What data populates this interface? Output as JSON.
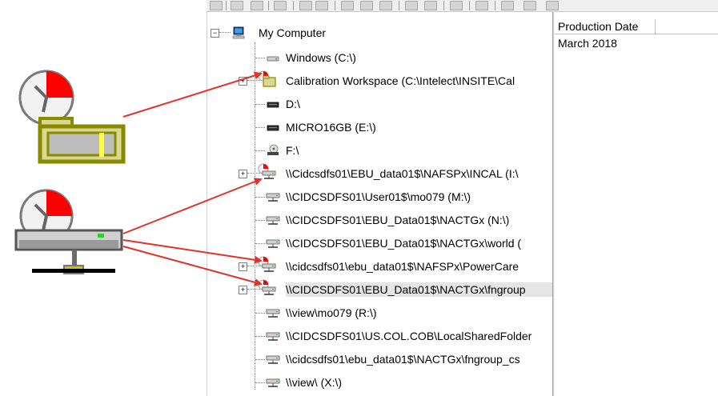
{
  "tree": {
    "root": {
      "label": "My Computer",
      "icon": "computer-icon"
    },
    "items": [
      {
        "label": "Windows  (C:\\)",
        "icon": "hard-drive-icon",
        "expandable": false
      },
      {
        "label": "Calibration Workspace  (C:\\Intelect\\INSITE\\Cal",
        "icon": "offline-shared-folder-icon",
        "expandable": true
      },
      {
        "label": "D:\\",
        "icon": "optical-drive-icon",
        "expandable": false
      },
      {
        "label": "MICRO16GB  (E:\\)",
        "icon": "removable-drive-icon",
        "expandable": false
      },
      {
        "label": "F:\\",
        "icon": "cd-drive-icon",
        "expandable": false
      },
      {
        "label": "\\\\Cidcsdfs01\\EBU_data01$\\NAFSPx\\INCAL  (I:\\",
        "icon": "offline-network-drive-icon",
        "expandable": true
      },
      {
        "label": "\\\\CIDCSDFS01\\User01$\\mo079  (M:\\)",
        "icon": "network-drive-icon",
        "expandable": false
      },
      {
        "label": "\\\\CIDCSDFS01\\EBU_Data01$\\NACTGx  (N:\\)",
        "icon": "network-drive-icon",
        "expandable": false
      },
      {
        "label": "\\\\CIDCSDFS01\\EBU_Data01$\\NACTGx\\world  (",
        "icon": "network-drive-icon",
        "expandable": false
      },
      {
        "label": "\\\\cidcsdfs01\\ebu_data01$\\NAFSPx\\PowerCare",
        "icon": "offline-network-drive-icon",
        "expandable": true
      },
      {
        "label": "\\\\CIDCSDFS01\\EBU_Data01$\\NACTGx\\fngroup",
        "icon": "offline-network-drive-icon",
        "expandable": true,
        "selected": true
      },
      {
        "label": "\\\\view\\mo079  (R:\\)",
        "icon": "network-drive-icon",
        "expandable": false
      },
      {
        "label": "\\\\CIDCSDFS01\\US.COL.COB\\LocalSharedFolder",
        "icon": "network-drive-icon",
        "expandable": false
      },
      {
        "label": "\\\\cidcsdfs01\\ebu_data01$\\NACTGx\\fngroup_cs",
        "icon": "network-drive-icon",
        "expandable": false
      },
      {
        "label": "\\\\view\\  (X:\\)",
        "icon": "network-drive-icon",
        "expandable": false
      }
    ]
  },
  "details": {
    "column_header": "Production Date",
    "value": "March 2018"
  },
  "annotations": {
    "large_icons": [
      "offline-folder-icon-enlarged",
      "offline-network-drive-icon-enlarged"
    ],
    "arrow_color": "#e0332b"
  },
  "colors": {
    "offline_badge_red": "#ff0000",
    "folder_olive": "#8a8a00",
    "selection_gray": "#e5e5e5"
  }
}
